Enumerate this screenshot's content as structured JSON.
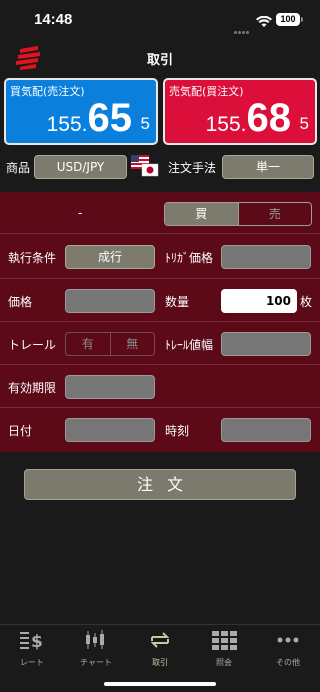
{
  "status": {
    "time": "14:48",
    "battery": "100"
  },
  "header": {
    "title": "取引"
  },
  "buy_panel": {
    "title": "買気配(売注文)",
    "price_main": "155.",
    "price_big": "65",
    "price_small": "5",
    "color": "#0a7fdc"
  },
  "sell_panel": {
    "title": "売気配(買注文)",
    "price_main": "155.",
    "price_big": "68",
    "price_small": "5",
    "color": "#dc0f3a"
  },
  "product": {
    "label": "商品",
    "value": "USD/JPY",
    "method_label": "注文手法",
    "method_value": "単一"
  },
  "side": {
    "dash": "-",
    "buy": "買",
    "sell": "売"
  },
  "exec": {
    "label": "執行条件",
    "value": "成行",
    "trigger_label": "ﾄﾘｶﾞ価格"
  },
  "price": {
    "label": "価格",
    "qty_label": "数量",
    "qty_value": "100",
    "qty_unit": "枚"
  },
  "trail": {
    "label": "トレール",
    "on": "有",
    "off": "無",
    "width_label": "ﾄﾚｰﾙ値幅"
  },
  "expiry": {
    "label": "有効期限"
  },
  "date": {
    "label": "日付",
    "time_label": "時刻"
  },
  "order_button": "注文",
  "tabs": [
    {
      "label": "レート",
      "icon": "rate-icon"
    },
    {
      "label": "チャート",
      "icon": "chart-icon"
    },
    {
      "label": "取引",
      "icon": "trade-icon"
    },
    {
      "label": "照会",
      "icon": "inquiry-icon"
    },
    {
      "label": "その他",
      "icon": "more-icon"
    }
  ]
}
